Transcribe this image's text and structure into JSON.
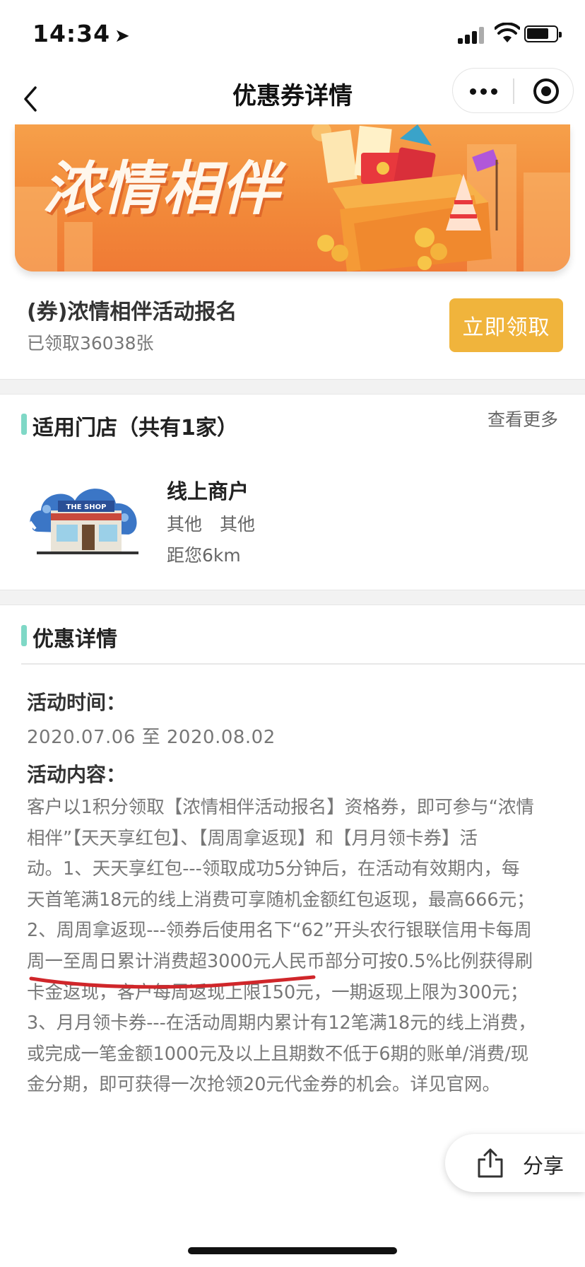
{
  "status": {
    "time": "14:34",
    "location_icon": "location-arrow-icon",
    "signal_icon": "cellular-signal-icon",
    "wifi_icon": "wifi-icon",
    "battery_icon": "battery-icon"
  },
  "nav": {
    "title": "优惠券详情",
    "back_icon": "chevron-left-icon",
    "more_icon": "more-dots-icon",
    "close_icon": "miniprogram-close-icon"
  },
  "banner": {
    "title": "浓情相伴"
  },
  "coupon": {
    "name": "(券)浓情相伴活动报名",
    "count": "已领取36038张",
    "claim_label": "立即领取",
    "accent_color": "#f0b43c"
  },
  "stores": {
    "title": "适用门店（共有1家）",
    "see_more": "查看更多",
    "items": [
      {
        "image_label": "THE SHOP",
        "name": "线上商户",
        "tags": "其他　其他",
        "distance": "距您6km"
      }
    ]
  },
  "details": {
    "title": "优惠详情",
    "time_label": "活动时间：",
    "time_value": "2020.07.06 至 2020.08.02",
    "content_label": "活动内容：",
    "content_lines": [
      "客户以1积分领取【浓情相伴活动报名】资格券，即可参与“浓情",
      "相伴”【天天享红包】、【周周拿返现】和【月月领卡券】活",
      "动。1、天天享红包---领取成功5分钟后，在活动有效期内，每",
      "天首笔满18元的线上消费可享随机金额红包返现，最高666元；",
      "2、周周拿返现---领券后使用名下“62”开头农行银联信用卡每周",
      "周一至周日累计消费超3000元人民币部分可按0.5%比例获得刷",
      "卡金返现，客户每周返现上限150元，一期返现上限为300元；",
      "3、月月领卡券---在活动周期内累计有12笔满18元的线上消费，",
      "或完成一笔金额1000元及以上且期数不低于6期的账单/消费/现",
      "金分期，即可获得一次抢领20元代金券的机会。详见官网。"
    ],
    "section_bar_color": "#7fd8c6",
    "annotation_color": "#d0262a"
  },
  "share": {
    "label": "分享",
    "icon": "share-icon"
  }
}
